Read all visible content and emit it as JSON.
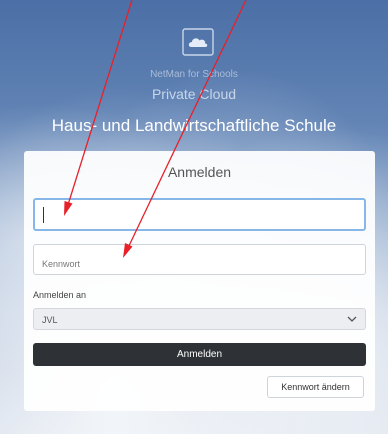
{
  "brand": {
    "product_line1": "NetMan for Schools",
    "product_line2": "Private Cloud",
    "school_name": "Haus- und Landwirtschaftliche Schule",
    "logo_icon": "cloud-icon"
  },
  "login": {
    "title": "Anmelden",
    "username_value": "",
    "password_placeholder": "Kennwort",
    "domain_label": "Anmelden an",
    "domain_selected": "JVL",
    "submit_label": "Anmelden",
    "change_password_label": "Kennwort ändern"
  },
  "colors": {
    "annotation_arrow": "#e8202a",
    "primary_button": "#2e3236",
    "focus_border": "#86b7e8"
  }
}
